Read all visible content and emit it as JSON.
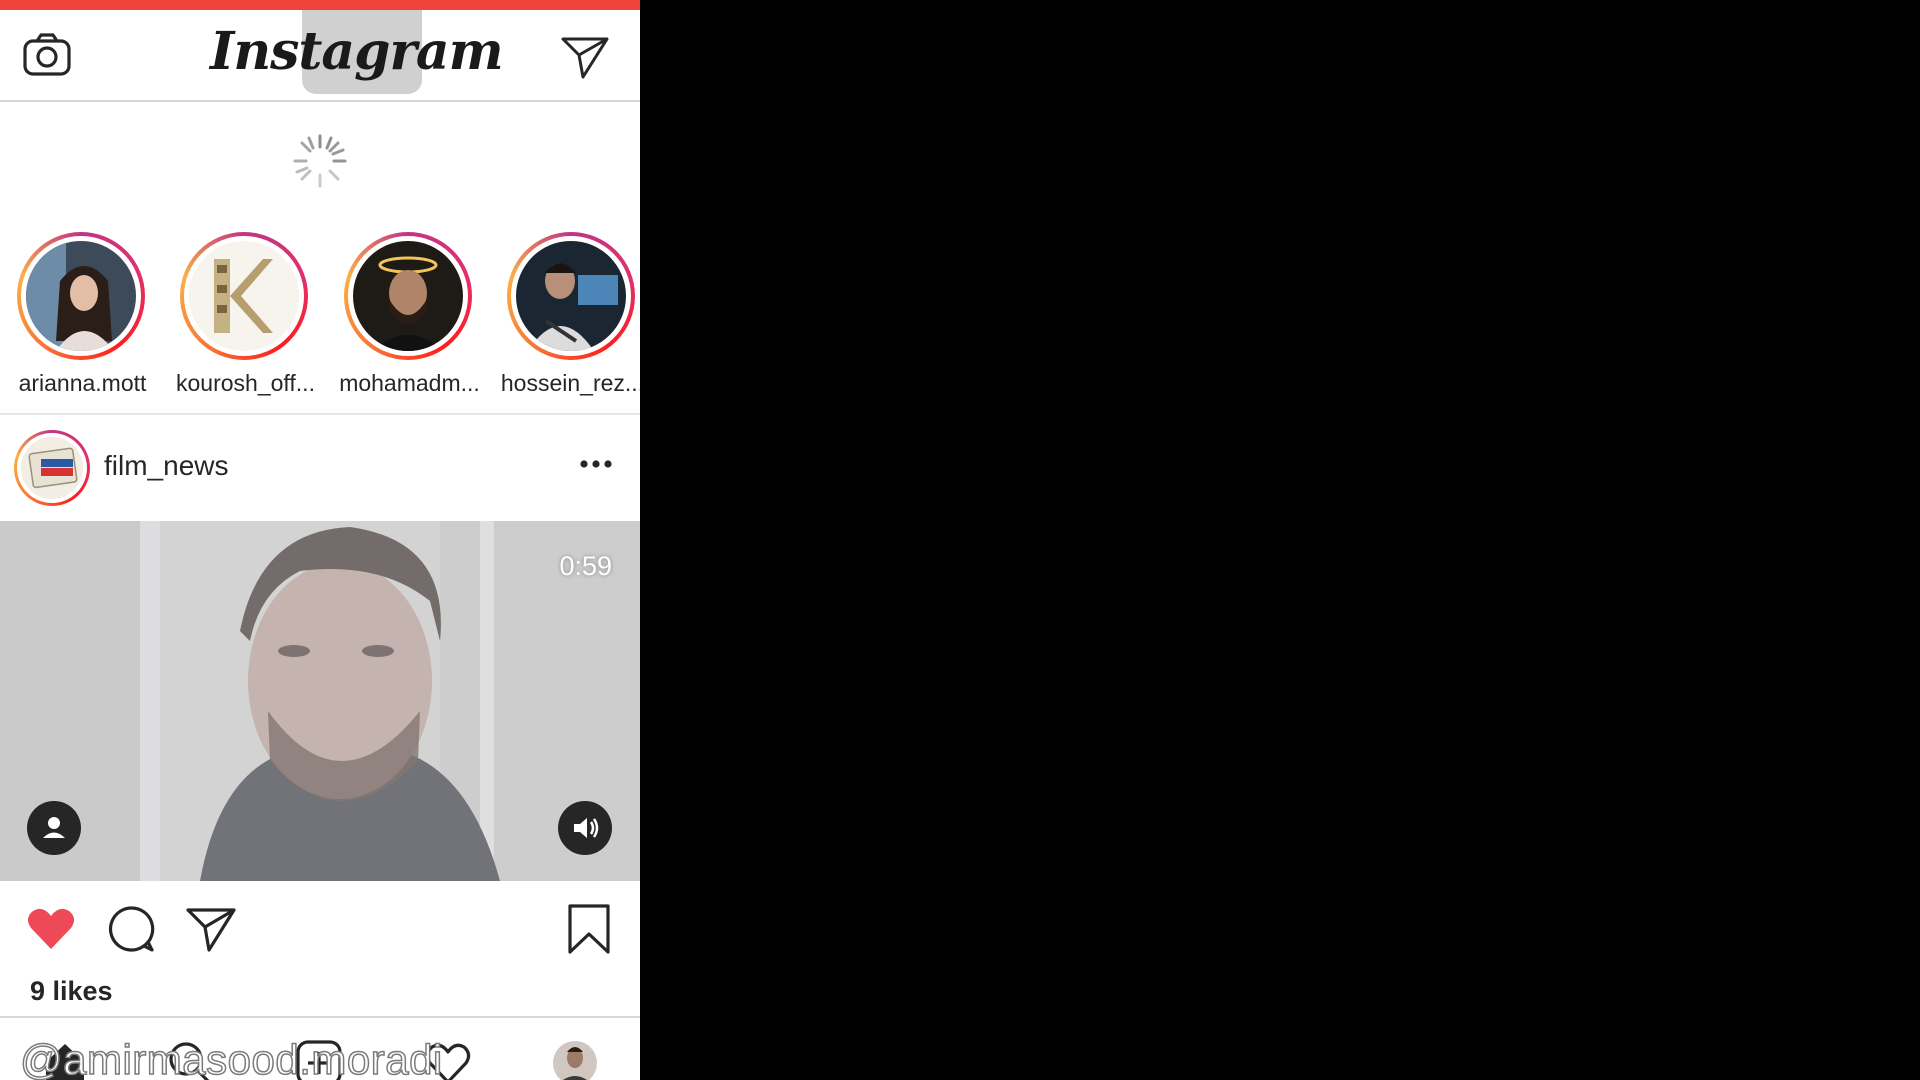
{
  "app": {
    "logo_text": "Instagram",
    "accent": "#f0433a"
  },
  "header": {
    "camera_icon": "camera-icon",
    "direct_icon": "paper-plane-icon"
  },
  "stories": [
    {
      "username": "arianna.mott"
    },
    {
      "username": "kourosh_off..."
    },
    {
      "username": "mohamadm..."
    },
    {
      "username": "hossein_rez..."
    }
  ],
  "post": {
    "username": "film_news",
    "video_duration": "0:59",
    "likes": "9 likes",
    "liked": true,
    "like_color": "#ed4956"
  },
  "tabbar": {
    "items": [
      "home-icon",
      "search-icon",
      "add-post-icon",
      "activity-icon",
      "profile-avatar"
    ]
  },
  "watermark": "@amirmasood.moradi"
}
